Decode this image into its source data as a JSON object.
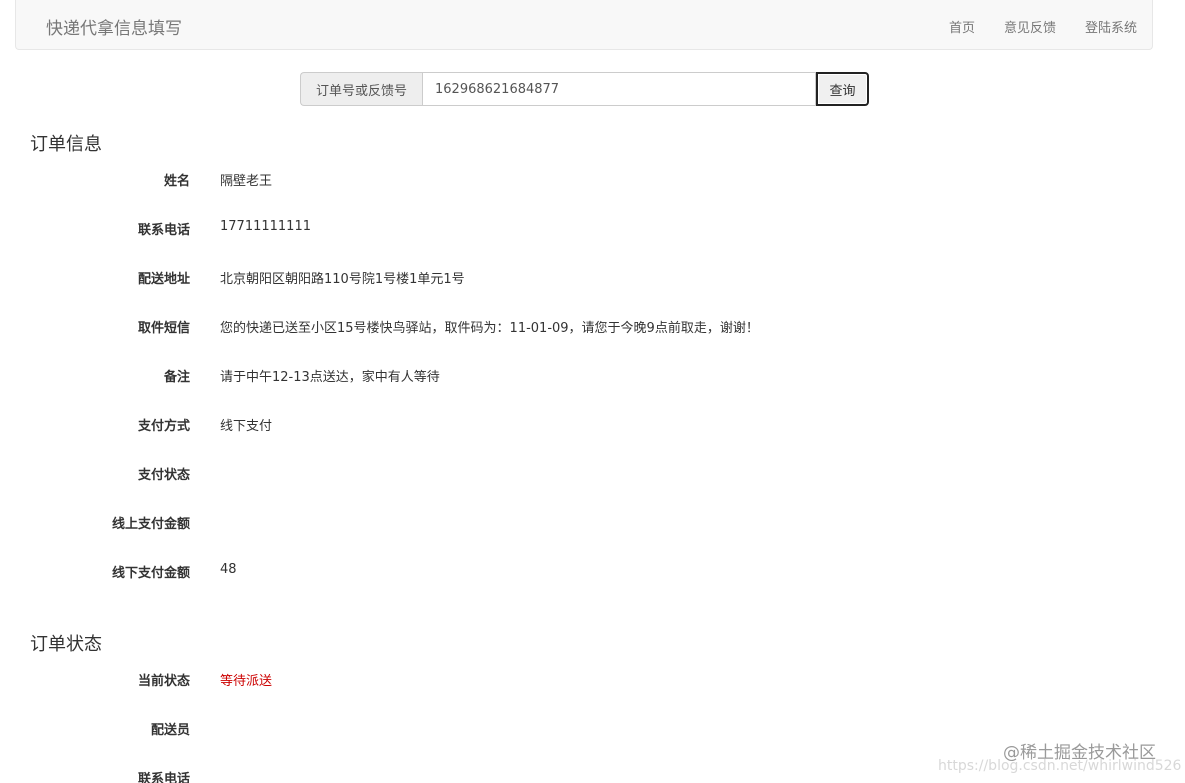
{
  "navbar": {
    "brand": "快递代拿信息填写",
    "links": [
      "首页",
      "意见反馈",
      "登陆系统"
    ]
  },
  "search": {
    "addon_label": "订单号或反馈号",
    "value": "162968621684877",
    "button_label": "查询"
  },
  "order_info": {
    "heading": "订单信息",
    "fields": [
      {
        "label": "姓名",
        "value": "隔壁老王"
      },
      {
        "label": "联系电话",
        "value": "17711111111"
      },
      {
        "label": "配送地址",
        "value": "北京朝阳区朝阳路110号院1号楼1单元1号"
      },
      {
        "label": "取件短信",
        "value": "您的快递已送至小区15号楼快鸟驿站，取件码为：11-01-09，请您于今晚9点前取走，谢谢！"
      },
      {
        "label": "备注",
        "value": "请于中午12-13点送达，家中有人等待"
      },
      {
        "label": "支付方式",
        "value": "线下支付"
      },
      {
        "label": "支付状态",
        "value": ""
      },
      {
        "label": "线上支付金额",
        "value": ""
      },
      {
        "label": "线下支付金额",
        "value": "48"
      }
    ]
  },
  "order_status": {
    "heading": "订单状态",
    "fields": [
      {
        "label": "当前状态",
        "value": "等待派送"
      },
      {
        "label": "配送员",
        "value": ""
      },
      {
        "label": "联系电话",
        "value": ""
      }
    ]
  },
  "watermark": {
    "brand": "@稀土掘金技术社区",
    "url": "https://blog.csdn.net/whirlwind526"
  },
  "colors": {
    "status_pending": "#cc0000",
    "navbar_bg": "#f8f8f8"
  }
}
